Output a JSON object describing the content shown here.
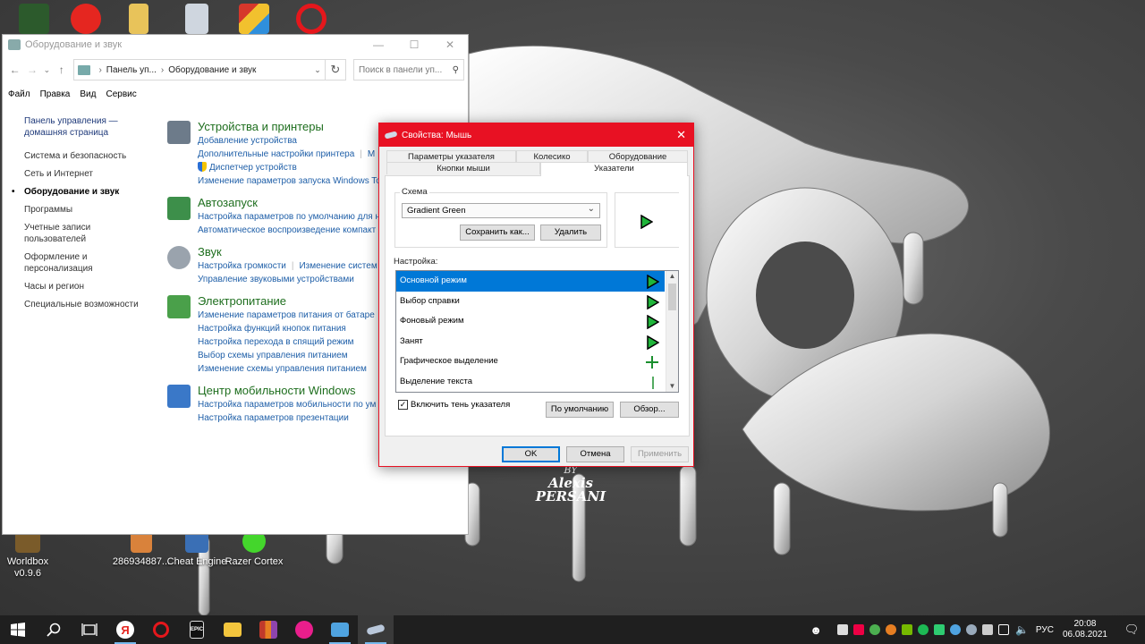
{
  "desktop": {
    "wallpaper_text": [
      "BY",
      "Alexis",
      "PERSANI"
    ],
    "icons_top": [
      {
        "name": "game-icon",
        "color": "#2c5a2c"
      },
      {
        "name": "yandex-browser-icon",
        "color": "#e52620"
      },
      {
        "name": "folder-icon",
        "color": "#e8c35a"
      },
      {
        "name": "recycle-bin-icon",
        "color": "#cfd6df"
      },
      {
        "name": "rubiks-cube-icon",
        "color": "#d6372b"
      },
      {
        "name": "opera-icon",
        "color": "#e5171c"
      }
    ],
    "icons_bottom": [
      {
        "label": "Worldbox\nv0.9.6",
        "name": "worldbox-icon",
        "color": "#7a5b2a"
      },
      {
        "label": "286934887...",
        "name": "file-icon",
        "color": "#d9823b"
      },
      {
        "label": "Cheat Engine",
        "name": "cheat-engine-icon",
        "color": "#3a6fb5"
      },
      {
        "label": "Razer Cortex",
        "name": "razer-cortex-icon",
        "color": "#44d62c"
      }
    ]
  },
  "control_panel": {
    "title": "Оборудование и звук",
    "address": {
      "root": "Панель уп...",
      "current": "Оборудование и звук"
    },
    "search_placeholder": "Поиск в панели уп...",
    "menu": [
      "Файл",
      "Правка",
      "Вид",
      "Сервис"
    ],
    "sidebar": [
      {
        "label": "Панель управления — домашняя страница"
      },
      {
        "label": "Система и безопасность"
      },
      {
        "label": "Сеть и Интернет"
      },
      {
        "label": "Оборудование и звук",
        "active": true
      },
      {
        "label": "Программы"
      },
      {
        "label": "Учетные записи пользователей"
      },
      {
        "label": "Оформление и персонализация"
      },
      {
        "label": "Часы и регион"
      },
      {
        "label": "Специальные возможности"
      }
    ],
    "categories": [
      {
        "title": "Устройства и принтеры",
        "icon": "printer-icon",
        "color": "#6d7b8a",
        "lines": [
          [
            "Добавление устройства"
          ],
          [
            "Дополнительные настройки принтера",
            "М"
          ],
          [
            "Диспетчер устройств"
          ],
          [
            "Изменение параметров запуска Windows To"
          ]
        ]
      },
      {
        "title": "Автозапуск",
        "icon": "autoplay-icon",
        "color": "#3d8f4a",
        "lines": [
          [
            "Настройка параметров по умолчанию для н"
          ],
          [
            "Автоматическое воспроизведение компакт"
          ]
        ]
      },
      {
        "title": "Звук",
        "icon": "speaker-icon",
        "color": "#9aa3ad",
        "lines": [
          [
            "Настройка громкости",
            "Изменение систем"
          ],
          [
            "Управление звуковыми устройствами"
          ]
        ]
      },
      {
        "title": "Электропитание",
        "icon": "power-icon",
        "color": "#4aa04a",
        "lines": [
          [
            "Изменение параметров питания от батаре"
          ],
          [
            "Настройка функций кнопок питания"
          ],
          [
            "Настройка перехода в спящий режим"
          ],
          [
            "Выбор схемы управления питанием"
          ],
          [
            "Изменение схемы управления питанием"
          ]
        ]
      },
      {
        "title": "Центр мобильности Windows",
        "icon": "mobility-center-icon",
        "color": "#3a78c8",
        "lines": [
          [
            "Настройка параметров мобильности по ум"
          ],
          [
            "Настройка параметров презентации"
          ]
        ]
      }
    ]
  },
  "mouse_dialog": {
    "title": "Свойства: Мышь",
    "tabs_row1": [
      "Параметры указателя",
      "Колесико",
      "Оборудование"
    ],
    "tabs_row2": [
      "Кнопки мыши",
      "Указатели"
    ],
    "active_tab": "Указатели",
    "scheme_label": "Схема",
    "scheme_value": "Gradient Green",
    "save_as_label": "Сохранить как...",
    "delete_label": "Удалить",
    "customize_label": "Настройка:",
    "cursors": [
      {
        "label": "Основной режим",
        "cursor": "arrow",
        "selected": true
      },
      {
        "label": "Выбор справки",
        "cursor": "arrow"
      },
      {
        "label": "Фоновый режим",
        "cursor": "arrow"
      },
      {
        "label": "Занят",
        "cursor": "arrow"
      },
      {
        "label": "Графическое выделение",
        "cursor": "cross"
      },
      {
        "label": "Выделение текста",
        "cursor": "beam"
      }
    ],
    "shadow_label": "Включить тень указателя",
    "shadow_checked": true,
    "default_label": "По умолчанию",
    "browse_label": "Обзор...",
    "ok_label": "OK",
    "cancel_label": "Отмена",
    "apply_label": "Применить",
    "accent_color": "#e81123",
    "cursor_color": "#1fb53a"
  },
  "taskbar": {
    "apps": [
      {
        "name": "task-view-icon",
        "color": "#ffffff"
      },
      {
        "name": "yandex-browser-icon",
        "color": "#e52620"
      },
      {
        "name": "opera-icon",
        "color": "#e5171c"
      },
      {
        "name": "epic-games-icon",
        "color": "#2a2a2a"
      },
      {
        "name": "file-explorer-icon",
        "color": "#f3c53d"
      },
      {
        "name": "app-grid-icon",
        "color": "#c0392b"
      },
      {
        "name": "dolphin-icon",
        "color": "#e91e8c"
      },
      {
        "name": "control-panel-icon",
        "color": "#4fa3e0"
      },
      {
        "name": "mouse-properties-icon",
        "color": "#b9c7da"
      }
    ],
    "tray_icons": [
      {
        "name": "epic-tray-icon",
        "color": "#ddd"
      },
      {
        "name": "media-tray-icon",
        "color": "#e04"
      },
      {
        "name": "chrome-tray-icon",
        "color": "#4caf50"
      },
      {
        "name": "disk-tray-icon",
        "color": "#e67e22"
      },
      {
        "name": "nvidia-tray-icon",
        "color": "#76b900"
      },
      {
        "name": "spotify-tray-icon",
        "color": "#1db954"
      },
      {
        "name": "green-tray-icon",
        "color": "#2ecc71"
      },
      {
        "name": "bluetooth-tray-icon",
        "color": "#4fa3e0"
      },
      {
        "name": "steam-tray-icon",
        "color": "#9ab"
      },
      {
        "name": "tools-tray-icon",
        "color": "#ccc"
      },
      {
        "name": "wifi-tray-icon",
        "color": "#fff"
      },
      {
        "name": "volume-tray-icon",
        "color": "#fff"
      }
    ],
    "language": "РУС",
    "time": "20:08",
    "date": "06.08.2021"
  }
}
